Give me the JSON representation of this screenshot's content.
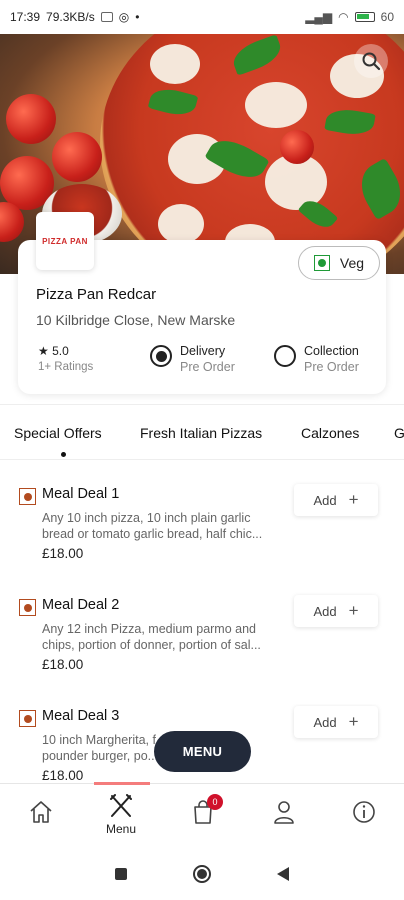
{
  "status_bar": {
    "time": "17:39",
    "speed": "79.3KB/s",
    "battery": "60"
  },
  "search": {
    "icon": "search-icon"
  },
  "restaurant": {
    "logo_text": "PIZZA PAN",
    "name": "Pizza Pan Redcar",
    "address": "10 Kilbridge Close, New Marske",
    "rating": "5.0",
    "ratings_count": "1+ Ratings",
    "veg_label": "Veg",
    "delivery": {
      "label": "Delivery",
      "sub": "Pre Order",
      "selected": true
    },
    "collection": {
      "label": "Collection",
      "sub": "Pre Order",
      "selected": false
    }
  },
  "tabs": [
    {
      "label": "Special Offers",
      "active": true
    },
    {
      "label": "Fresh Italian Pizzas",
      "active": false
    },
    {
      "label": "Calzones",
      "active": false
    },
    {
      "label": "G",
      "active": false
    }
  ],
  "menu_items": [
    {
      "name": "Meal Deal 1",
      "desc_line1": "Any 10 inch pizza, 10 inch plain garlic",
      "desc_line2": "bread or tomato garlic bread, half chic...",
      "price": "£18.00",
      "add_label": "Add"
    },
    {
      "name": "Meal Deal 2",
      "desc_line1": "Any 12 inch Pizza, medium parmo and",
      "desc_line2": "chips, portion of donner, portion of sal...",
      "price": "£18.00",
      "add_label": "Add"
    },
    {
      "name": "Meal Deal 3",
      "desc_line1": "10 inch Margherita, f...          ter",
      "desc_line2": "pounder burger, po...                or...",
      "price": "£18.00",
      "add_label": "Add"
    }
  ],
  "floating_menu_label": "MENU",
  "bottom_nav": {
    "menu_label": "Menu",
    "cart_count": "0"
  },
  "colors": {
    "accent_dark": "#222a3a",
    "veg_green": "#1f9a37",
    "nonveg_brown": "#b24b1f",
    "badge_red": "#d0112b",
    "nav_indicator": "#f47c7c"
  }
}
